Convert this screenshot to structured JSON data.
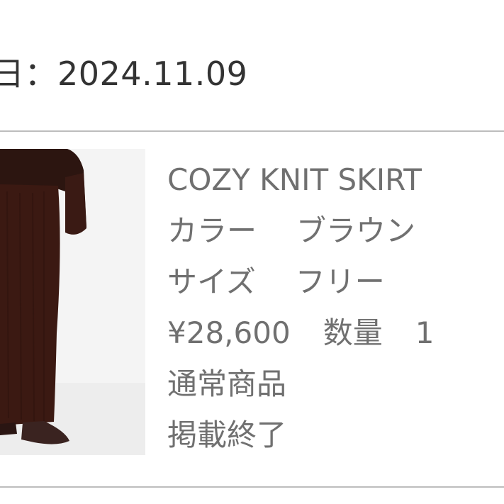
{
  "order": {
    "date_label": "日",
    "date_separator": "：",
    "date_value": "2024.11.09"
  },
  "product": {
    "image_icon": "skirt-photo",
    "name": "COZY KNIT SKIRT",
    "color_label": "カラー",
    "color_value": "ブラウン",
    "size_label": "サイズ",
    "size_value": "フリー",
    "price": "¥28,600",
    "quantity_label": "数量",
    "quantity_value": "1",
    "item_type": "通常商品",
    "status": "掲載終了"
  },
  "colors": {
    "text_dark": "#333333",
    "text_gray": "#707070",
    "divider": "#bdbdbd",
    "garment": "#3a1a14"
  }
}
